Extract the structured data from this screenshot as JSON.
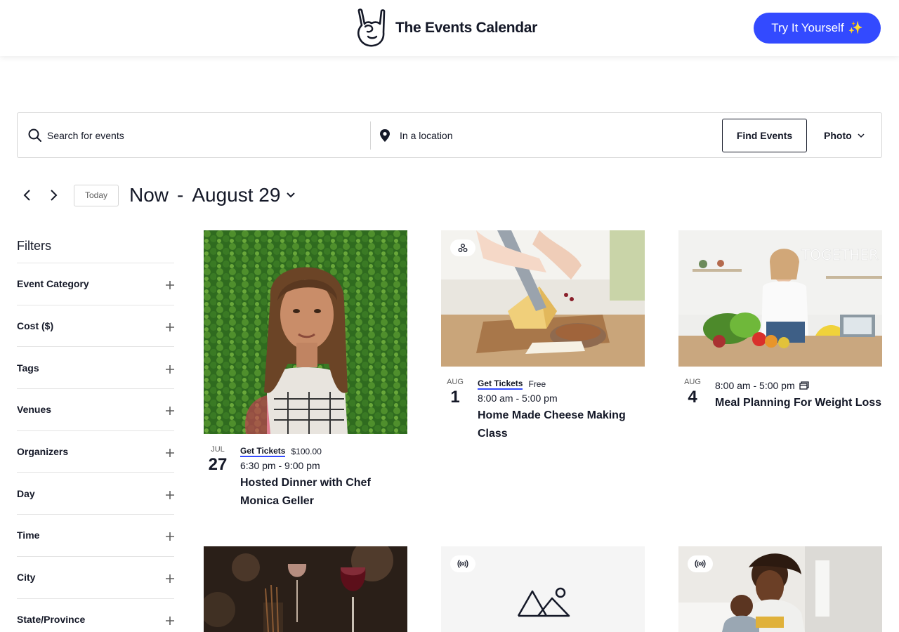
{
  "header": {
    "brand_name": "The Events Calendar",
    "cta_label": "Try It Yourself",
    "cta_emoji": "✨",
    "accent_color": "#334aff"
  },
  "search": {
    "keyword_placeholder": "Search for events",
    "location_placeholder": "In a location",
    "submit_label": "Find Events",
    "view_label": "Photo"
  },
  "date_nav": {
    "today_label": "Today",
    "range_start": "Now",
    "range_separator": "-",
    "range_end": "August 29"
  },
  "filters": {
    "title": "Filters",
    "items": [
      {
        "label": "Event Category"
      },
      {
        "label": "Cost ($)"
      },
      {
        "label": "Tags"
      },
      {
        "label": "Venues"
      },
      {
        "label": "Organizers"
      },
      {
        "label": "Day"
      },
      {
        "label": "Time"
      },
      {
        "label": "City"
      },
      {
        "label": "State/Province"
      }
    ]
  },
  "events": [
    {
      "month": "JUL",
      "day": "27",
      "ticket_label": "Get Tickets",
      "price": "$100.00",
      "time": "6:30 pm - 9:00 pm",
      "title": "Hosted Dinner with Chef Monica Geller",
      "image": "portrait-woman-photo"
    },
    {
      "month": "AUG",
      "day": "1",
      "ticket_label": "Get Tickets",
      "price": "Free",
      "time": "8:00 am - 5:00 pm",
      "title": "Home Made Cheese Making Class",
      "image": "cheese-cutting-photo",
      "badge_icon": "hybrid-event-icon"
    },
    {
      "month": "AUG",
      "day": "4",
      "time": "8:00 am - 5:00 pm",
      "title": "Meal Planning For Weight Loss",
      "image": "kitchen-vegetables-photo",
      "recurring_icon": "recurring-event-icon",
      "sign_text": "TOGETHER"
    },
    {
      "image": "wine-glasses-photo"
    },
    {
      "image": "placeholder-image",
      "badge_icon": "virtual-event-icon"
    },
    {
      "image": "family-kitchen-photo",
      "badge_icon": "virtual-event-icon"
    }
  ]
}
